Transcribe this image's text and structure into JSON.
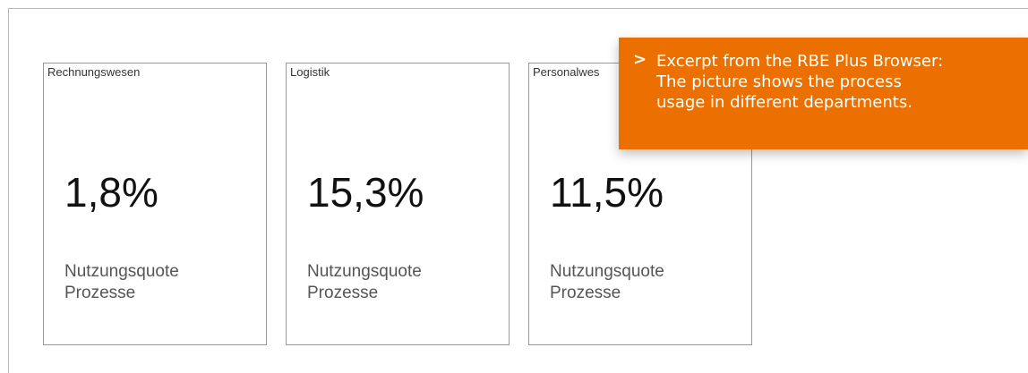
{
  "tiles": [
    {
      "title": "Rechnungswesen",
      "value": "1,8%",
      "caption_line1": "Nutzungsquote",
      "caption_line2": "Prozesse"
    },
    {
      "title": "Logistik",
      "value": "15,3%",
      "caption_line1": "Nutzungsquote",
      "caption_line2": "Prozesse"
    },
    {
      "title": "Personalwes",
      "value": "11,5%",
      "caption_line1": "Nutzungsquote",
      "caption_line2": "Prozesse"
    }
  ],
  "callout": {
    "marker": ">",
    "line1": "Excerpt from the RBE Plus Browser:",
    "line2": "The picture shows the process",
    "line3": "usage in different departments."
  },
  "colors": {
    "callout_bg": "#ec7000",
    "tile_border": "#9a9a9a",
    "frame_border": "#b9b9b9"
  }
}
